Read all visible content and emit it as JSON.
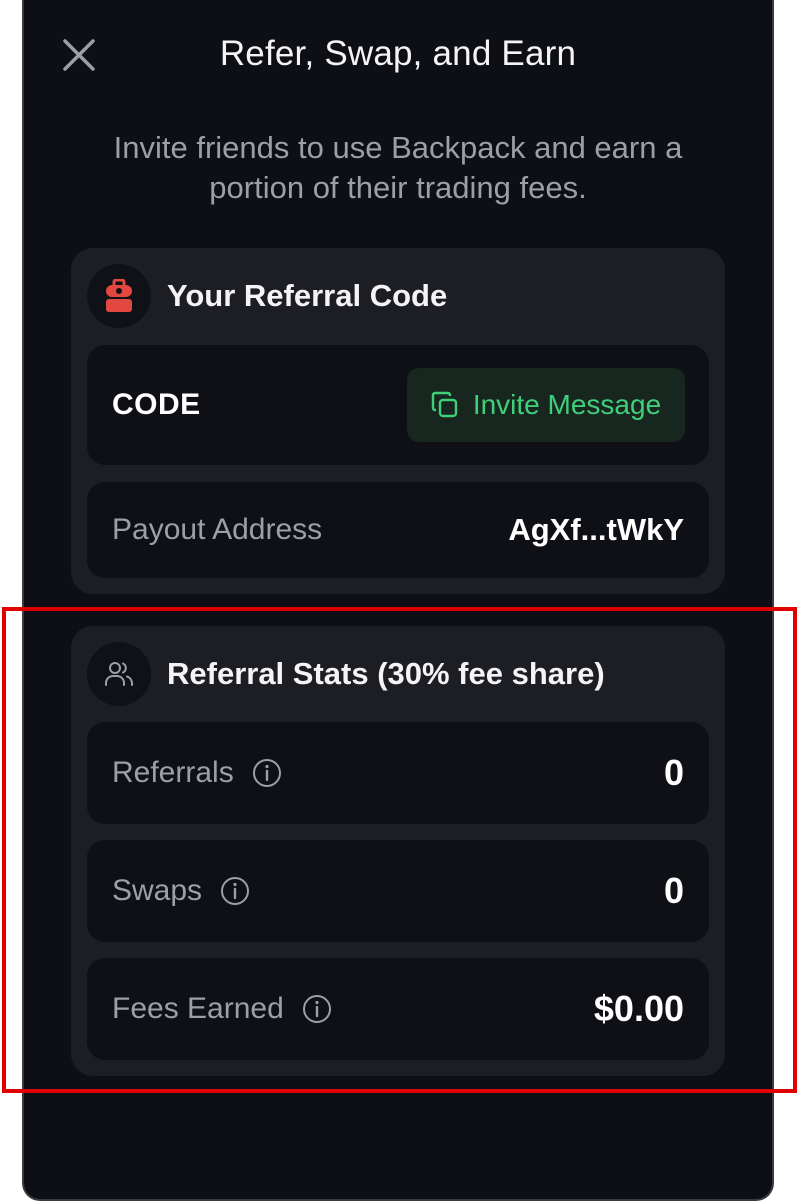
{
  "header": {
    "title": "Refer, Swap, and Earn",
    "subtitle": "Invite friends to use Backpack and earn a portion of their trading fees."
  },
  "referral_code_card": {
    "title": "Your Referral Code",
    "code_label": "CODE",
    "invite_button_label": "Invite Message",
    "payout_label": "Payout Address",
    "payout_value": "AgXf...tWkY"
  },
  "stats_card": {
    "title": "Referral Stats (30% fee share)",
    "rows": [
      {
        "label": "Referrals",
        "value": "0"
      },
      {
        "label": "Swaps",
        "value": "0"
      },
      {
        "label": "Fees Earned",
        "value": "$0.00"
      }
    ]
  },
  "colors": {
    "background": "#0e0f14",
    "card": "#1d1e24",
    "row": "#0f1015",
    "accent_green": "#3fcf7a",
    "backpack_red": "#e2483f",
    "highlight_red": "#e00000"
  },
  "icons": {
    "close": "close-icon",
    "backpack": "backpack-icon",
    "copy": "copy-icon",
    "users": "users-icon",
    "info": "info-icon"
  }
}
